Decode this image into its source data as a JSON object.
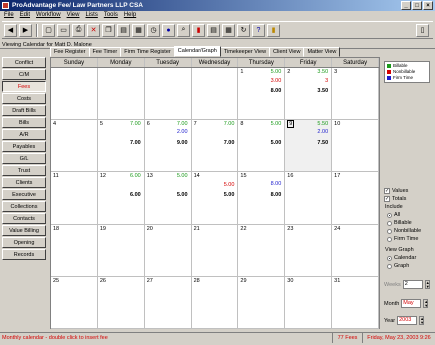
{
  "window": {
    "title": "ProAdvantage Fee/ Law Partners LLP  CSA"
  },
  "menu": [
    "File",
    "Edit",
    "Workflow",
    "View",
    "Lists",
    "Tools",
    "Help"
  ],
  "caption": "Viewing Calendar for Matt D. Malone",
  "sidebar": [
    "Conflict",
    "C/M",
    "Fees",
    "Costs",
    "Draft Bills",
    "Bills",
    "A/R",
    "Payables",
    "G/L",
    "Trust",
    "Clients",
    "Executive",
    "Collections",
    "Contacts",
    "Value Billing",
    "Opening",
    "Records"
  ],
  "sidebar_active": "Fees",
  "tabs": [
    "Fee Register",
    "Fee Timer",
    "Firm Time Register",
    "Calendar/Graph",
    "Timekeeper View",
    "Client View",
    "Matter View"
  ],
  "tab_active": "Calendar/Graph",
  "days": [
    "Sunday",
    "Monday",
    "Tuesday",
    "Wednesday",
    "Thursday",
    "Friday",
    "Saturday"
  ],
  "weeks": [
    [
      {
        "n": ""
      },
      {
        "n": ""
      },
      {
        "n": ""
      },
      {
        "n": ""
      },
      {
        "n": "1",
        "v1": "5.00",
        "v3": "3.00",
        "tot": "8.00"
      },
      {
        "n": "2",
        "v1": "3.50",
        "v3": "3",
        "tot": "3.50"
      },
      {
        "n": "3"
      }
    ],
    [
      {
        "n": "4"
      },
      {
        "n": "5",
        "v1": "7.00",
        "tot": "7.00"
      },
      {
        "n": "6",
        "v1": "7.00",
        "v2": "2.00",
        "tot": "9.00"
      },
      {
        "n": "7",
        "v1": "7.00",
        "tot": "7.00"
      },
      {
        "n": "8",
        "v1": "5.00",
        "tot": "5.00"
      },
      {
        "n": "9",
        "v1": "5.50",
        "v2": "2.00",
        "tot": "7.50",
        "sel": true
      },
      {
        "n": "10"
      }
    ],
    [
      {
        "n": "11"
      },
      {
        "n": "12",
        "v1": "6.00",
        "tot": "6.00"
      },
      {
        "n": "13",
        "v1": "5.00",
        "tot": "5.00"
      },
      {
        "n": "14",
        "v1": "",
        "v3": "5.00",
        "tot": "5.00"
      },
      {
        "n": "15",
        "v2": "8.00",
        "tot": "8.00"
      },
      {
        "n": "16"
      },
      {
        "n": "17"
      }
    ],
    [
      {
        "n": "18"
      },
      {
        "n": "19"
      },
      {
        "n": "20"
      },
      {
        "n": "21"
      },
      {
        "n": "22"
      },
      {
        "n": "23"
      },
      {
        "n": "24"
      }
    ],
    [
      {
        "n": "25"
      },
      {
        "n": "26"
      },
      {
        "n": "27"
      },
      {
        "n": "28"
      },
      {
        "n": "29"
      },
      {
        "n": "30"
      },
      {
        "n": "31"
      }
    ]
  ],
  "legend": [
    {
      "label": "Billable",
      "color": "#1a9a1a"
    },
    {
      "label": "Nonbillable",
      "color": "#d40000"
    },
    {
      "label": "Firm Time",
      "color": "#1a1acc"
    }
  ],
  "options": {
    "values_label": "Values",
    "values_checked": true,
    "totals_label": "Totals",
    "totals_checked": true,
    "include_label": "Include",
    "include": [
      "All",
      "Billable",
      "Nonbillable",
      "Firm Time"
    ],
    "include_selected": "All",
    "view_label": "View Graph",
    "view": [
      "Calendar",
      "Graph"
    ],
    "view_selected": "Calendar",
    "weeks_label": "Weeks",
    "weeks_value": "2",
    "month_label": "Month",
    "month_value": "May",
    "year_label": "Year",
    "year_value": "2003"
  },
  "status": {
    "hint": "Monthly calendar - double click to insert fee",
    "count": "77 Fees",
    "datetime": "Friday, May 23, 2003 9:26 AM"
  }
}
